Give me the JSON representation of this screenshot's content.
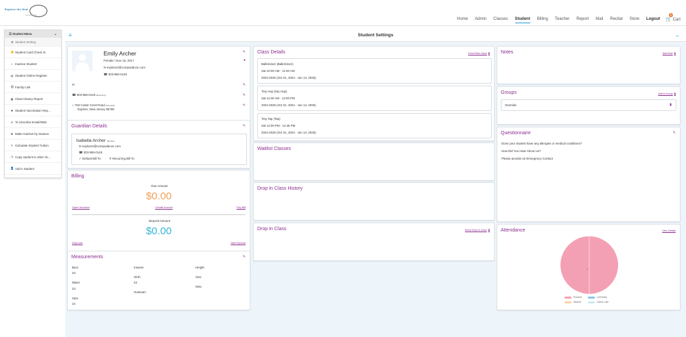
{
  "logo": {
    "line1": "Explore the New",
    "line2": "compudance"
  },
  "nav": {
    "items": [
      "Home",
      "Admin",
      "Classes",
      "Student",
      "Billing",
      "Teacher",
      "Report",
      "Mail",
      "Recital",
      "Store"
    ],
    "logout": "Logout",
    "cart": "Cart",
    "cart_count": "0",
    "active": "Student"
  },
  "sidebar": {
    "header": "Student Menu",
    "items": [
      {
        "icon": "",
        "label": "Student Setting"
      },
      {
        "icon": "▣",
        "label": "Student Card Check In"
      },
      {
        "icon": "▣",
        "label": "Inactive Student"
      },
      {
        "icon": "▣",
        "label": "Student Online Register"
      },
      {
        "icon": "▣",
        "label": "Family Link"
      },
      {
        "icon": "▣",
        "label": "Class History Report"
      },
      {
        "icon": "▣",
        "label": "Student Vaccination Rep..."
      },
      {
        "icon": "⊘",
        "label": "To Unscribe Email/SMS"
      },
      {
        "icon": "▣",
        "label": "Make Inactive by Season"
      },
      {
        "icon": "✎",
        "label": "Calculate Student Tuition"
      },
      {
        "icon": "▣",
        "label": "Copy student to other Sc..."
      },
      {
        "icon": "+",
        "label": "Add A Student"
      }
    ]
  },
  "page": {
    "title": "Student Settings"
  },
  "student": {
    "name": "Emily Archer",
    "gender_dob": "Female / Nov 15, 2017",
    "email": "explore2@compudance.com",
    "phone": "303-555-0145",
    "phone2": "303-555-0145",
    "phone2_tag": "(Business)",
    "address_line1": "763 Cedar Crest Road",
    "address_tag": "(Physical)",
    "address_line2": "Explore, New Jersey 56780"
  },
  "guardian": {
    "title": "Guardian Details",
    "name": "Isabella Archer",
    "relation": "(Mother)",
    "email": "explore2@compudance.com",
    "phone": "303-555-0145",
    "default_bill": "Default Bill To",
    "recurring_bill": "Recurring Bill To"
  },
  "billing": {
    "title": "Billing",
    "due_label": "Due Amount",
    "due_amount": "$0.00",
    "open_invoices": "Open Invoices",
    "create_invoice": "Create Invoice",
    "pay_bill": "Pay Bill",
    "deposit_label": "Deposit Amount",
    "deposit_amount": "$0.00",
    "deposits": "Deposits",
    "add_deposit": "Add Deposit",
    "due_color": "#f0a25a",
    "deposit_color": "#35b6d8"
  },
  "measurements": {
    "title": "Measurements",
    "bust_label": "Bust",
    "bust": "23",
    "waist_label": "Waist",
    "waist": "23",
    "hips_label": "Hips",
    "hips": "24",
    "inseam_label": "Inseam",
    "girth_label": "Girth",
    "girth": "42",
    "outseam_label": "Outseam",
    "height_label": "Height",
    "size_label": "Size",
    "misc_label": "Misc"
  },
  "class_details": {
    "title": "Class Details",
    "enroll_link": "Enroll New Class",
    "classes": [
      {
        "name": "Ballet/Jazz (Ballet/Jazz)",
        "time": "Sat 10:00 AM - 11:00 AM",
        "season": "2024-2025 (Oct 01, 2024 - Jun 14, 2025)"
      },
      {
        "name": "Tiny Hop (Hip Hop)",
        "time": "Sat 11:00 AM - 12:00 PM",
        "season": "2024-2025 (Oct 01, 2024 - Jun 14, 2025)"
      },
      {
        "name": "Tiny Tap (Tap)",
        "time": "Sat 12:00 PM - 12:45 PM",
        "season": "2024-2025 (Oct 01, 2024 - Jun 14, 2025)"
      }
    ]
  },
  "waitlist": {
    "title": "Waitlist Classes"
  },
  "dropin_history": {
    "title": "Drop In Class History"
  },
  "dropin": {
    "title": "Drop In Class",
    "enroll_link": "Enroll Drop In Class"
  },
  "notes": {
    "title": "Notes",
    "add_link": "Add Note"
  },
  "groups": {
    "title": "Groups",
    "add_link": "Add to Group",
    "items": [
      "Override"
    ]
  },
  "questionnaire": {
    "title": "Questionnaire",
    "questions": [
      "Does your student have any allergies or medical conditions?",
      "How Did You Hear About Us?",
      "Please provide an Emergency Contact"
    ]
  },
  "attendance": {
    "title": "Attendance",
    "view_link": "View Details",
    "center_label": "1",
    "legend": [
      {
        "label": "Present",
        "color": "#f4a0b4"
      },
      {
        "label": "Left Early",
        "color": "#8ec3e8"
      },
      {
        "label": "Absent",
        "color": "#f8d5a3"
      },
      {
        "label": "Came Late",
        "color": "#cfe9f0"
      }
    ]
  },
  "chart_data": {
    "type": "pie",
    "categories": [
      "Present",
      "Left Early",
      "Absent",
      "Came Late"
    ],
    "values": [
      1,
      0,
      0,
      0
    ]
  }
}
